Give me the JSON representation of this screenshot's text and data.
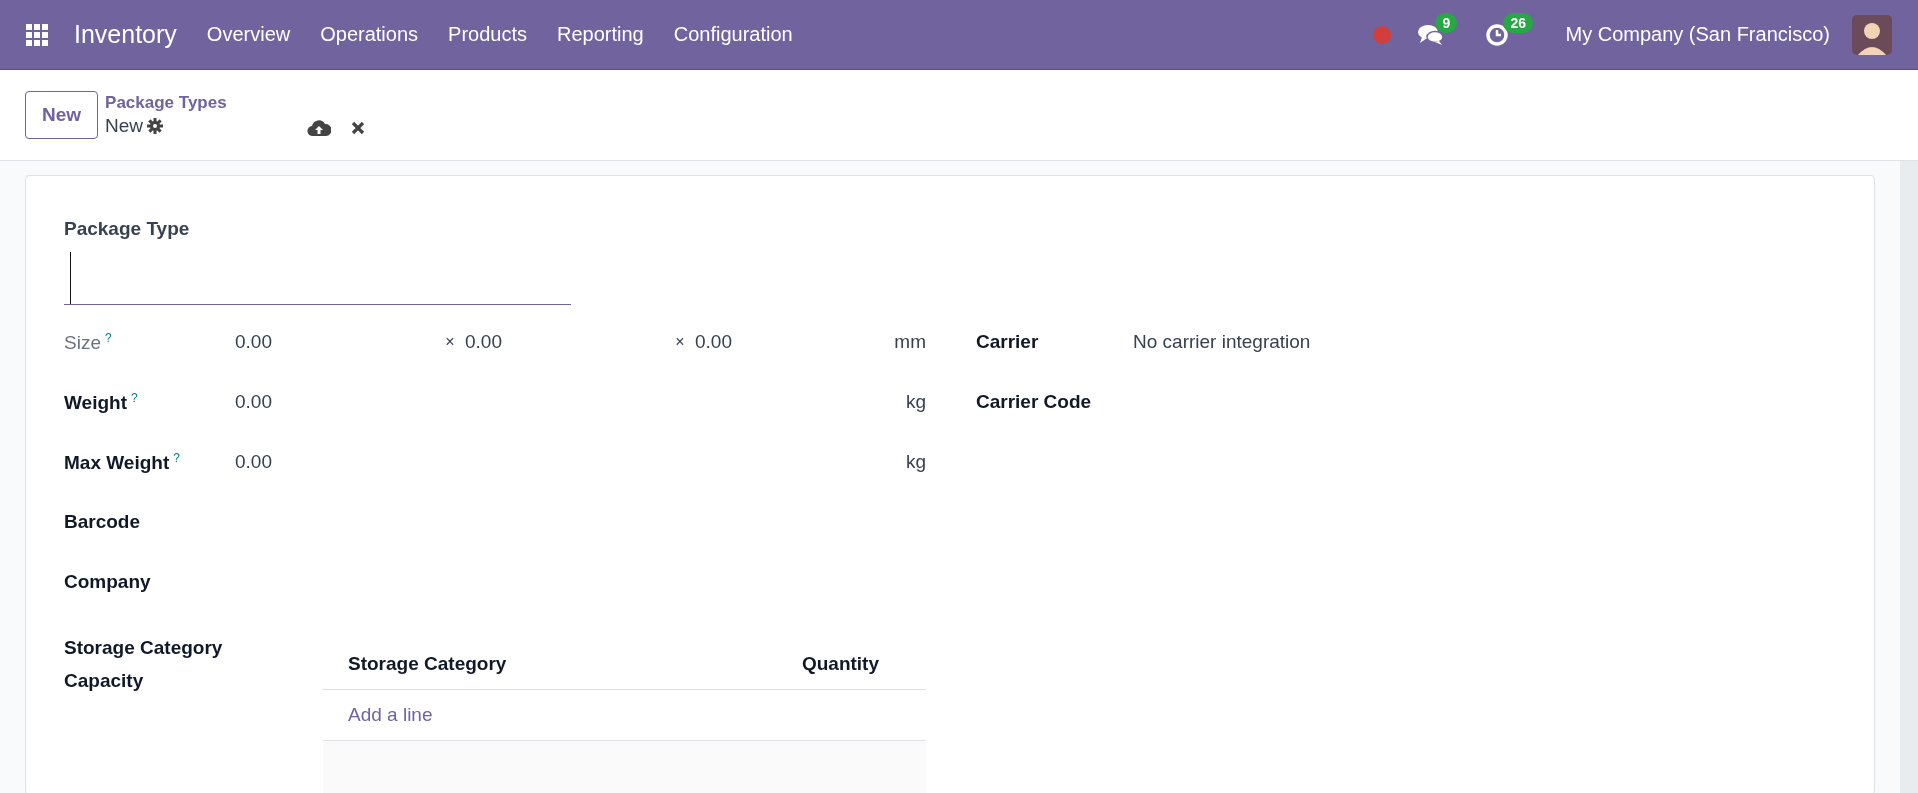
{
  "navbar": {
    "app_name": "Inventory",
    "menu": [
      "Overview",
      "Operations",
      "Products",
      "Reporting",
      "Configuration"
    ],
    "messages_count": "9",
    "activities_count": "26",
    "company": "My Company (San Francisco)"
  },
  "control_panel": {
    "new_button": "New",
    "breadcrumb": "Package Types",
    "record": "New"
  },
  "form": {
    "title_label": "Package Type",
    "left_fields": [
      {
        "kind": "dimensions",
        "label": "Size",
        "help": "?",
        "disabled": true,
        "values": [
          "0.00",
          "0.00",
          "0.00"
        ],
        "separator": "×",
        "unit": "mm"
      },
      {
        "kind": "measure",
        "label": "Weight",
        "help": "?",
        "disabled": false,
        "values": [
          "0.00"
        ],
        "unit": "kg"
      },
      {
        "kind": "measure",
        "label": "Max Weight",
        "help": "?",
        "disabled": false,
        "values": [
          "0.00"
        ],
        "unit": "kg"
      },
      {
        "kind": "empty",
        "label": "Barcode",
        "disabled": false
      },
      {
        "kind": "empty",
        "label": "Company",
        "disabled": false
      }
    ],
    "right_fields": [
      {
        "label": "Carrier",
        "value": "No carrier integration"
      },
      {
        "label": "Carrier Code"
      }
    ],
    "capacity": {
      "label": "Storage Category Capacity",
      "columns": [
        "Storage Category",
        "Quantity"
      ],
      "add_line": "Add a line"
    }
  }
}
